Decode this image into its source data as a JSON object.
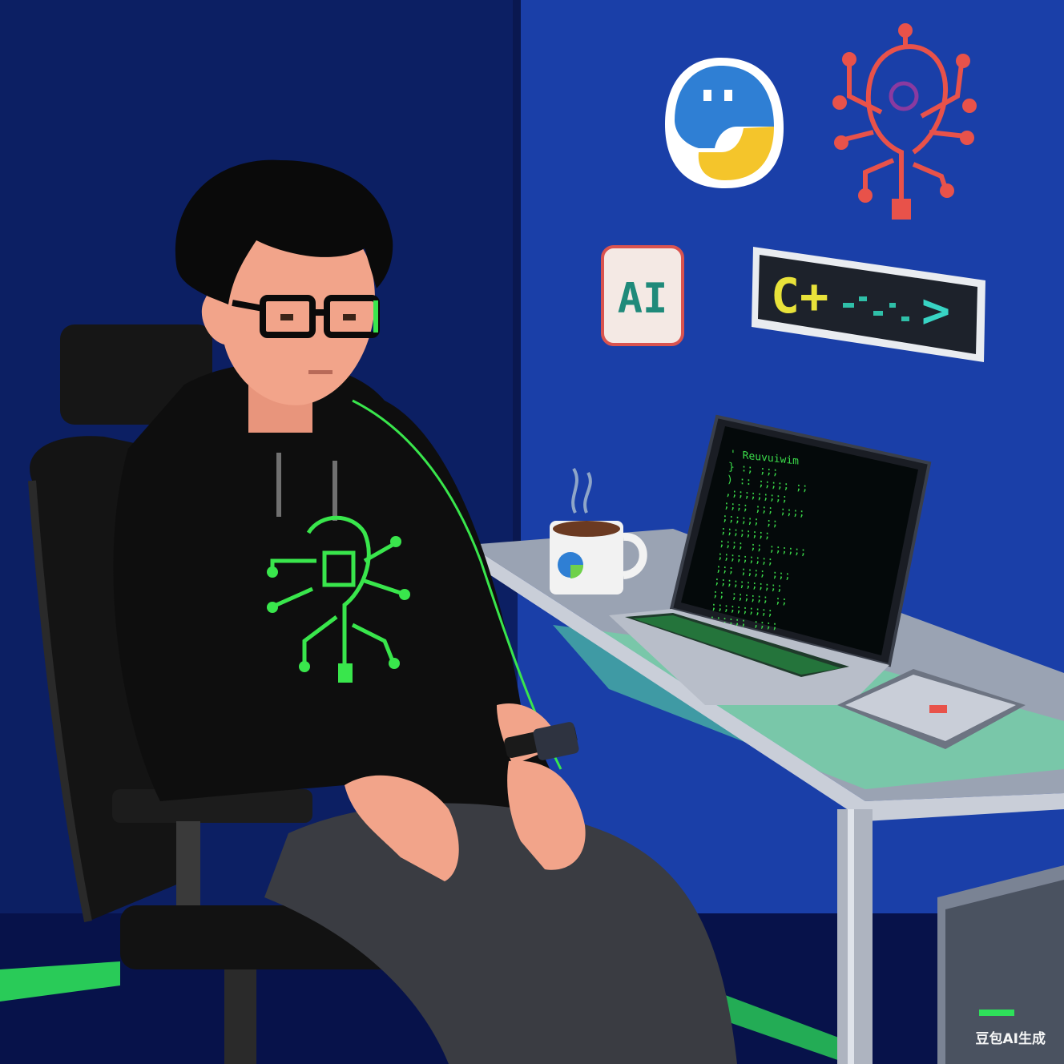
{
  "scene": {
    "stickers": {
      "ai_label": "AI",
      "cpp_label": "C+",
      "cpp_arrow": ">"
    },
    "laptop": {
      "code_lines": [
        "' Reuvuiwim",
        "} :; ;;;",
        "  ) :: ;;;;; ;;",
        "  ,;;;;;;;;;",
        "  ;;;; ;;; ;;;;",
        "  ;;;;;; ;;",
        "  ;;;;;;;;",
        "  ;;;; ;; ;;;;;;",
        "  ;;;;;;;;;",
        "  ;;; ;;;; ;;;",
        "  ;;;;;;;;;;;",
        "  ;; ;;;;;; ;;",
        "  ;;;;;;;;;;",
        "  ;;;;;; ;;;;",
        "  ;;;;;;;;"
      ]
    },
    "watermark": "豆包AI生成"
  },
  "colors": {
    "wall_left": "#0c1f63",
    "wall_right": "#1a3fa8",
    "neon_green": "#39e64c",
    "hoodie": "#0e0e0e",
    "desk": "#9aa3b3",
    "skin": "#f2a48a",
    "python_blue": "#2f7fd4",
    "python_yellow": "#f4c52b",
    "circuit_red": "#e8524a"
  },
  "icons": [
    "python-logo-icon",
    "circuit-brain-icon",
    "ai-badge-icon",
    "cpp-code-icon",
    "coffee-steam-icon"
  ]
}
